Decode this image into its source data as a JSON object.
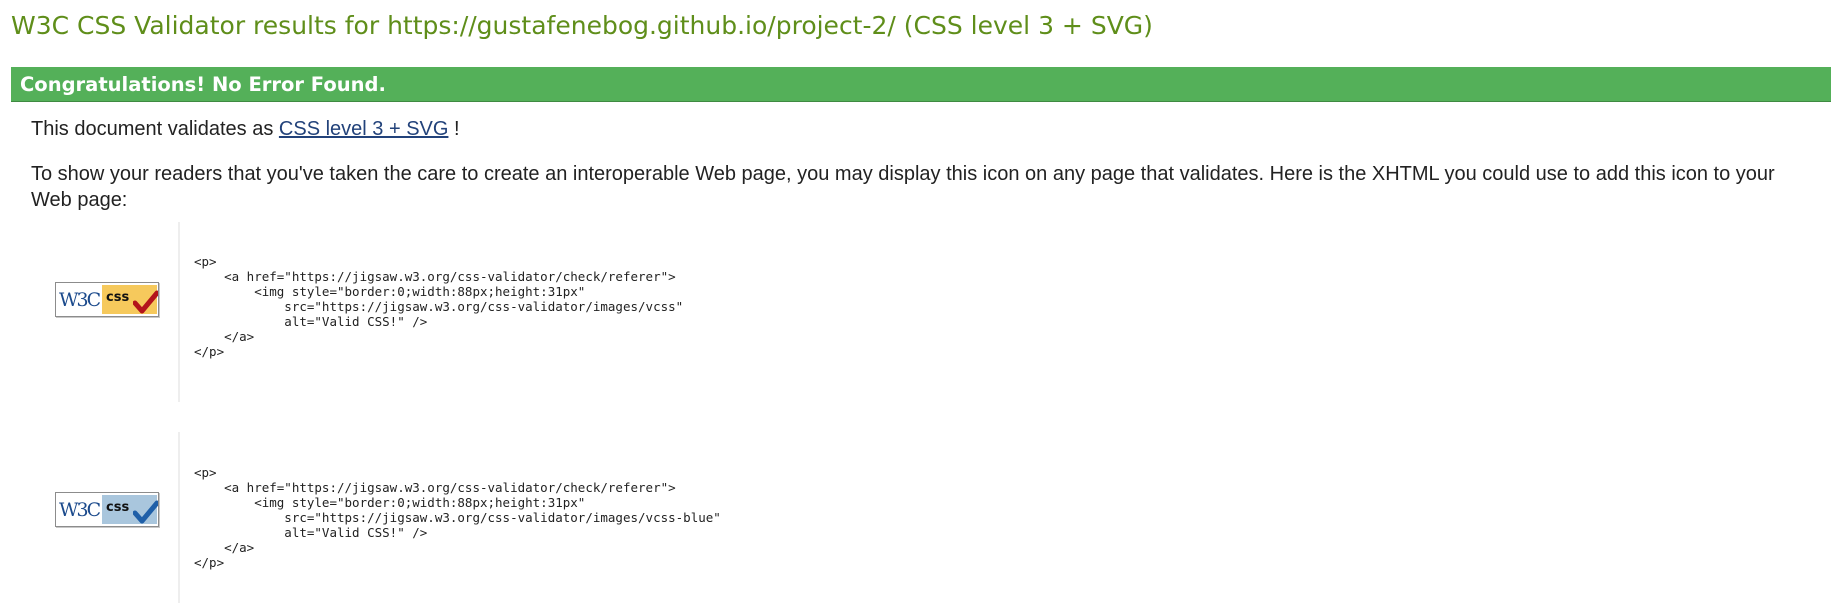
{
  "page": {
    "title": "W3C CSS Validator results for https://gustafenebog.github.io/project-2/ (CSS level 3 + SVG)"
  },
  "banner": {
    "text": "Congratulations! No Error Found.",
    "color": "#54b059"
  },
  "validation": {
    "prefix": "This document validates as",
    "profile_link": "CSS level 3 + SVG",
    "suffix": "!"
  },
  "intro": {
    "text": "To show your readers that you've taken the care to create an interoperable Web page, you may display this icon on any page that validates. Here is the XHTML you could use to add this icon to your Web page:"
  },
  "icons": [
    {
      "badge_w3c": "W3C",
      "badge_css": "css",
      "variant": "gold",
      "icon_name": "valid-css-gold-badge-icon",
      "code": "<p>\n    <a href=\"https://jigsaw.w3.org/css-validator/check/referer\">\n        <img style=\"border:0;width:88px;height:31px\"\n            src=\"https://jigsaw.w3.org/css-validator/images/vcss\"\n            alt=\"Valid CSS!\" />\n    </a>\n</p>"
    },
    {
      "badge_w3c": "W3C",
      "badge_css": "css",
      "variant": "blue",
      "icon_name": "valid-css-blue-badge-icon",
      "code": "<p>\n    <a href=\"https://jigsaw.w3.org/css-validator/check/referer\">\n        <img style=\"border:0;width:88px;height:31px\"\n            src=\"https://jigsaw.w3.org/css-validator/images/vcss-blue\"\n            alt=\"Valid CSS!\" />\n    </a>\n</p>"
    }
  ],
  "colors": {
    "title": "#5f8e1a",
    "link": "#22427a",
    "gold_badge": "#f6c95c",
    "blue_badge": "#a9c6dd",
    "gold_check": "#b3141b",
    "blue_check": "#1f5fa8"
  }
}
